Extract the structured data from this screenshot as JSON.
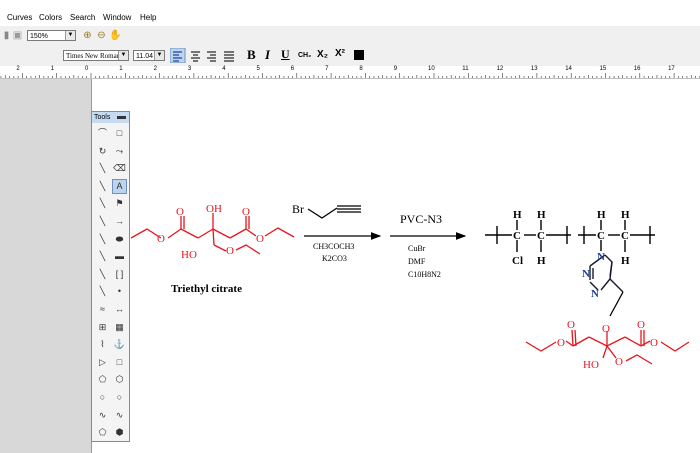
{
  "menu": [
    "Curves",
    "Colors",
    "Search",
    "Window",
    "Help"
  ],
  "toolbar": {
    "zoom_value": "150%",
    "font_name": "Times New Roman",
    "font_size": "11.04",
    "bold_label": "B",
    "italic_label": "I",
    "underline_label": "U",
    "formula_label": "CH₂",
    "subscript_label": "X₂",
    "superscript_label": "X²"
  },
  "ruler_labels": [
    "2",
    "1",
    "0",
    "1",
    "2",
    "3",
    "4",
    "5",
    "6",
    "7",
    "8",
    "9",
    "10",
    "11",
    "12",
    "13",
    "14",
    "15",
    "16",
    "17"
  ],
  "tools_panel": {
    "title": "Tools"
  },
  "scheme": {
    "reactant_name": "Triethyl citrate",
    "reagent_propargyl": "Br",
    "step1_conditions": [
      "CH3COCH3",
      "K2CO3"
    ],
    "step2_reagent": "PVC-N3",
    "step2_conditions": [
      "CuBr",
      "DMF",
      "C10H8N2"
    ],
    "atoms": {
      "O": "O",
      "OH": "OH",
      "HO": "HO",
      "H": "H",
      "C": "C",
      "Cl": "Cl",
      "N": "N"
    }
  },
  "colors": {
    "highlight_red": "#e8141c",
    "tools_title_bg": "#c5dbf2",
    "workspace_gray": "#d8d8d8"
  }
}
